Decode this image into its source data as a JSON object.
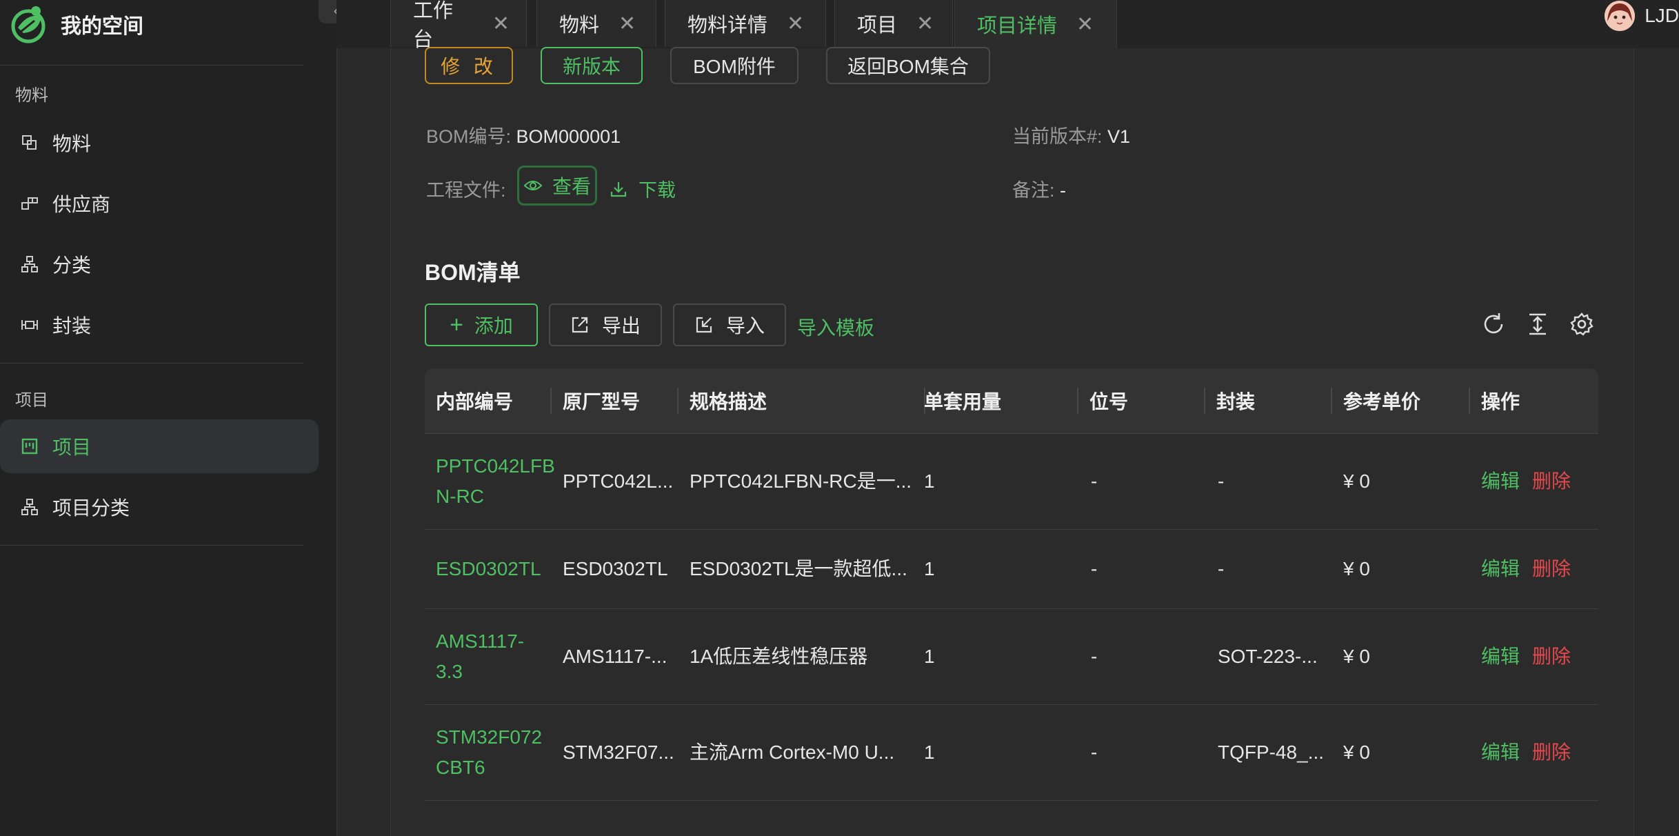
{
  "app": {
    "title": "我的空间"
  },
  "sidebar": {
    "groups": [
      {
        "title": "物料",
        "items": [
          "物料",
          "供应商",
          "分类",
          "封装"
        ]
      },
      {
        "title": "项目",
        "items": [
          "项目",
          "项目分类"
        ]
      }
    ]
  },
  "tabs": [
    {
      "label": "工作台"
    },
    {
      "label": "物料"
    },
    {
      "label": "物料详情"
    },
    {
      "label": "项目"
    },
    {
      "label": "项目详情",
      "active": true
    }
  ],
  "user": {
    "name": "LJD"
  },
  "actions": {
    "modify": "修 改",
    "new_version": "新版本",
    "bom_attachment": "BOM附件",
    "back": "返回BOM集合"
  },
  "info": {
    "bom_no_label": "BOM编号:",
    "bom_no_value": "BOM000001",
    "version_label": "当前版本#:",
    "version_value": "V1",
    "file_label": "工程文件:",
    "view": "查看",
    "download": "下载",
    "note_label": "备注:",
    "note_value": "-"
  },
  "bom": {
    "title": "BOM清单",
    "add": "添加",
    "export": "导出",
    "import": "导入",
    "template": "导入模板",
    "columns": [
      "内部编号",
      "原厂型号",
      "规格描述",
      "单套用量",
      "位号",
      "封装",
      "参考单价",
      "操作"
    ],
    "rows": [
      {
        "code1": "PPTC042LFB",
        "code2": "N-RC",
        "model": "PPTC042L...",
        "desc": "PPTC042LFBN-RC是一...",
        "qty": "1",
        "pos": "-",
        "pkg": "-",
        "price": "¥ 0"
      },
      {
        "code1": "ESD0302TL",
        "code2": "",
        "model": "ESD0302TL",
        "desc": "ESD0302TL是一款超低...",
        "qty": "1",
        "pos": "-",
        "pkg": "-",
        "price": "¥ 0"
      },
      {
        "code1": "AMS1117-",
        "code2": "3.3",
        "model": "AMS1117-...",
        "desc": "1A低压差线性稳压器",
        "qty": "1",
        "pos": "-",
        "pkg": "SOT-223-...",
        "price": "¥ 0"
      },
      {
        "code1": "STM32F072",
        "code2": "CBT6",
        "model": "STM32F07...",
        "desc": "主流Arm Cortex-M0 U...",
        "qty": "1",
        "pos": "-",
        "pkg": "TQFP-48_...",
        "price": "¥ 0"
      }
    ],
    "edit": "编辑",
    "delete": "删除"
  },
  "colors": {
    "accent": "#4fbf64",
    "danger": "#e5484d",
    "warning": "#e5a435"
  }
}
